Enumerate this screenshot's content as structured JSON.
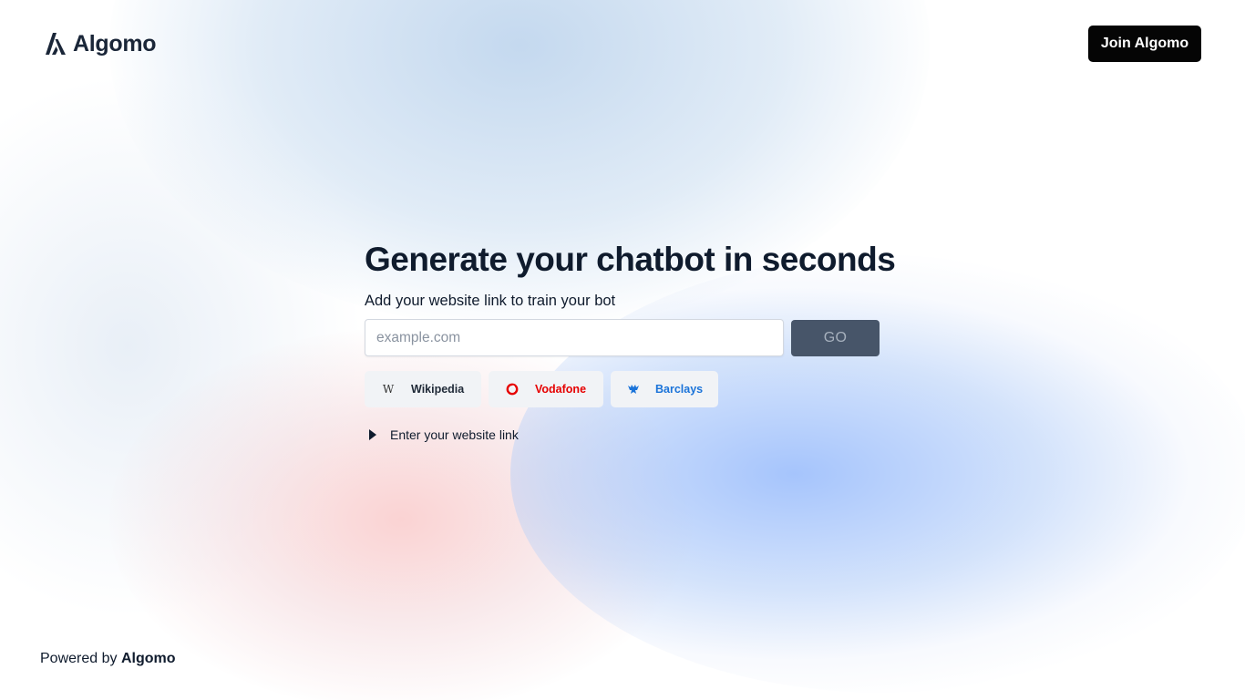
{
  "header": {
    "brand": "Algomo",
    "join_button": "Join Algomo"
  },
  "main": {
    "title": "Generate your chatbot in seconds",
    "subtitle": "Add your website link to train your bot",
    "url_input": {
      "value": "",
      "placeholder": "example.com"
    },
    "go_button": "GO",
    "examples": [
      {
        "label": "Wikipedia",
        "icon": "wikipedia-icon",
        "color": "#1f2937"
      },
      {
        "label": "Vodafone",
        "icon": "vodafone-icon",
        "color": "#e60000"
      },
      {
        "label": "Barclays",
        "icon": "barclays-eagle-icon",
        "color": "#1a73d9"
      }
    ],
    "details_toggle": "Enter your website link"
  },
  "footer": {
    "prefix": "Powered by",
    "brand": "Algomo"
  },
  "colors": {
    "primary_dark": "#050505",
    "go_button_bg": "#475569",
    "text": "#0f1b2d"
  }
}
